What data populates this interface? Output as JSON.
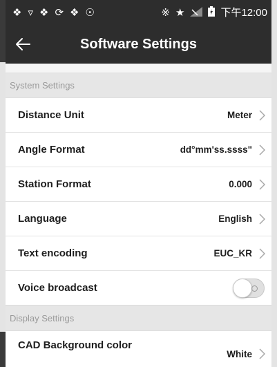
{
  "status_bar": {
    "time": "下午12:00",
    "left_icons": [
      "app-icon",
      "wifi-icon",
      "app-icon",
      "sync-icon",
      "app-icon",
      "pin-icon"
    ],
    "right_icons": [
      "bluetooth-icon",
      "star-icon",
      "signal-icon",
      "battery-icon"
    ]
  },
  "app_bar": {
    "title": "Software Settings",
    "back_icon": "back-arrow-icon"
  },
  "sections": {
    "system": {
      "header": "System Settings",
      "distance_unit": {
        "label": "Distance Unit",
        "value": "Meter"
      },
      "angle_format": {
        "label": "Angle Format",
        "value": "dd°mm'ss.ssss\""
      },
      "station_format": {
        "label": "Station Format",
        "value": "0.000"
      },
      "language": {
        "label": "Language",
        "value": "English"
      },
      "text_encoding": {
        "label": "Text encoding",
        "value": "EUC_KR"
      },
      "voice_broadcast": {
        "label": "Voice broadcast",
        "enabled": false
      }
    },
    "display": {
      "header": "Display Settings",
      "cad_background": {
        "label": "CAD Background color",
        "value": "White"
      }
    }
  },
  "colors": {
    "bar_background": "#2d2d2d",
    "section_header_bg": "#e6e6e6",
    "row_background": "#ffffff",
    "text_primary": "#1e1e1e",
    "text_muted": "#9a9a9a"
  }
}
